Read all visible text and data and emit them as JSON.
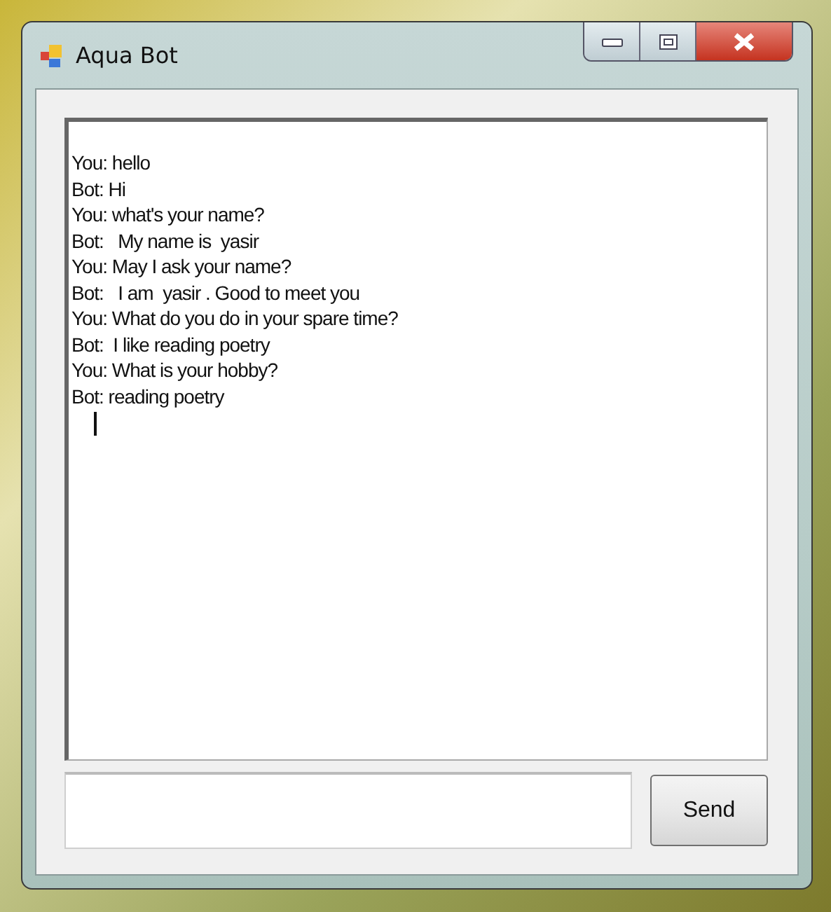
{
  "window": {
    "title": "Aqua Bot"
  },
  "chat_log": [
    "You: hello",
    "Bot: Hi",
    "You: what's your name?",
    "Bot:   My name is  yasir",
    "You: May I ask your name?",
    "Bot:   I am  yasir . Good to meet you",
    "You: What do you do in your spare time?",
    "Bot:  I like reading poetry",
    "You: What is your hobby?",
    "Bot: reading poetry"
  ],
  "send_button": {
    "label": "Send"
  }
}
